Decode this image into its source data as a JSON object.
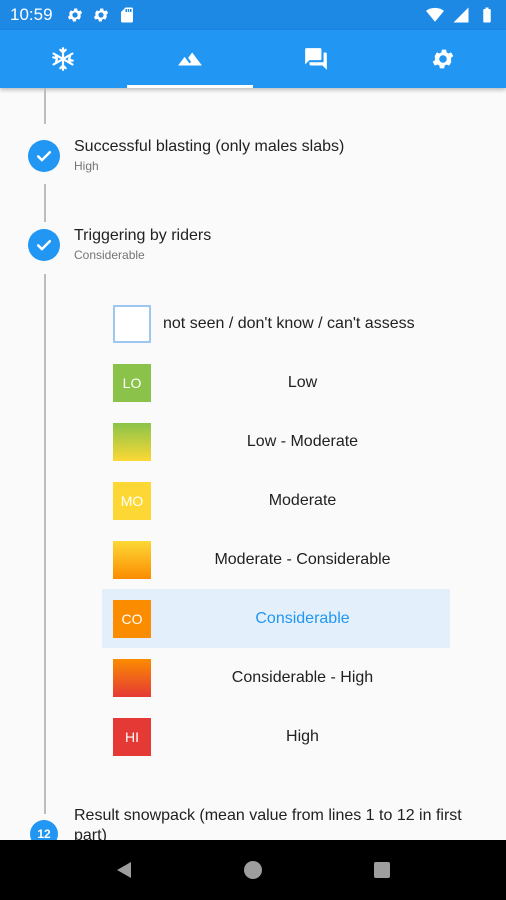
{
  "status": {
    "time": "10:59"
  },
  "tabs": [
    {
      "name": "snowflake-icon",
      "active": false
    },
    {
      "name": "mountain-icon",
      "active": true
    },
    {
      "name": "chat-icon",
      "active": false
    },
    {
      "name": "settings-icon",
      "active": false
    }
  ],
  "steps": [
    {
      "title": "Successful blasting (only males slabs)",
      "subtitle": "High"
    },
    {
      "title": "Triggering by riders",
      "subtitle": "Considerable"
    }
  ],
  "options": [
    {
      "code": "",
      "label": "not seen / don't know / can't assess",
      "color": "#ffffff",
      "selected": false
    },
    {
      "code": "LO",
      "label": "Low",
      "color": "#8bc34a",
      "selected": false
    },
    {
      "code": "",
      "label": "Low - Moderate",
      "color": "linear-gradient(#8bc34a,#fdd835)",
      "selected": false
    },
    {
      "code": "MO",
      "label": "Moderate",
      "color": "#fdd835",
      "selected": false
    },
    {
      "code": "",
      "label": "Moderate - Considerable",
      "color": "linear-gradient(#fdd835,#fb8c00)",
      "selected": false
    },
    {
      "code": "CO",
      "label": "Considerable",
      "color": "#fb8c00",
      "selected": true
    },
    {
      "code": "",
      "label": "Considerable - High",
      "color": "linear-gradient(#fb8c00,#e53935)",
      "selected": false
    },
    {
      "code": "HI",
      "label": "High",
      "color": "#e53935",
      "selected": false
    }
  ],
  "next_step": {
    "number": "12",
    "title": "Result snowpack (mean value from lines 1 to 12 in first part)"
  },
  "colors": {
    "primary": "#2196f3",
    "status_bar": "#1e88e5",
    "selected_row": "#e3f0fb"
  }
}
